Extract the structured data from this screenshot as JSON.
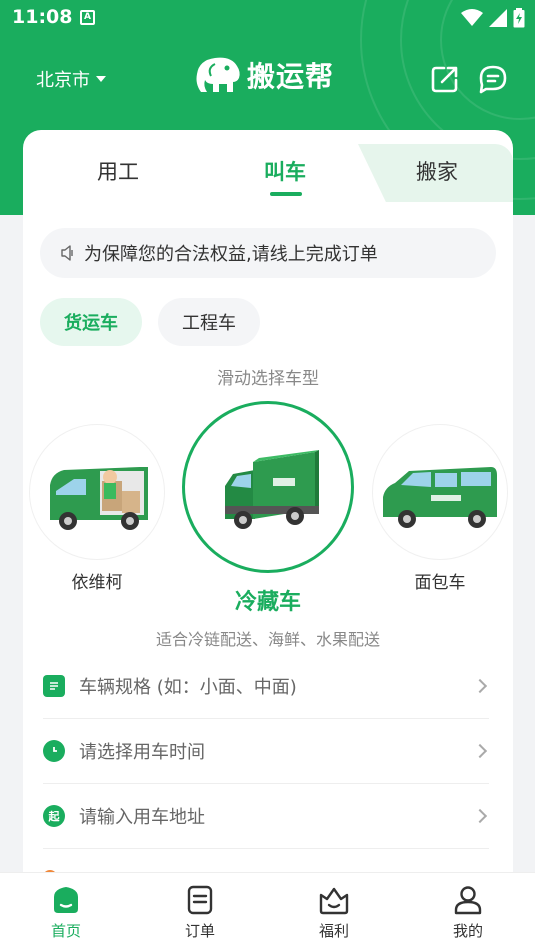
{
  "status_bar": {
    "time": "11:08",
    "notification_glyph": "A"
  },
  "header": {
    "city": "北京市",
    "brand": "搬运帮",
    "icons": [
      "share-icon",
      "message-icon"
    ]
  },
  "tabs": [
    {
      "label": "用工",
      "active": false
    },
    {
      "label": "叫车",
      "active": true
    },
    {
      "label": "搬家",
      "active": false
    }
  ],
  "notice": {
    "icon": "speaker-icon",
    "text": "为保障您的合法权益,请线上完成订单"
  },
  "categories": [
    {
      "label": "货运车",
      "active": true
    },
    {
      "label": "工程车",
      "active": false
    }
  ],
  "slide_hint": "滑动选择车型",
  "vehicles": [
    {
      "name": "依维柯",
      "selected": false
    },
    {
      "name": "冷藏车",
      "selected": true
    },
    {
      "name": "面包车",
      "selected": false
    }
  ],
  "vehicle_desc": "适合冷链配送、海鲜、水果配送",
  "form_rows": [
    {
      "icon": "spec-icon",
      "text": "车辆规格 (如：小面、中面)"
    },
    {
      "icon": "clock-icon",
      "text": "请选择用车时间"
    },
    {
      "icon": "start-icon",
      "icon_text": "起",
      "text": "请输入用车地址"
    }
  ],
  "bottom_nav": [
    {
      "label": "首页",
      "icon": "home-icon",
      "active": true
    },
    {
      "label": "订单",
      "icon": "order-icon",
      "active": false
    },
    {
      "label": "福利",
      "icon": "gift-icon",
      "active": false
    },
    {
      "label": "我的",
      "icon": "user-icon",
      "active": false
    }
  ],
  "colors": {
    "brand_green": "#1aad5e",
    "light_green": "#e6f7ee",
    "background": "#f2f3f5"
  }
}
